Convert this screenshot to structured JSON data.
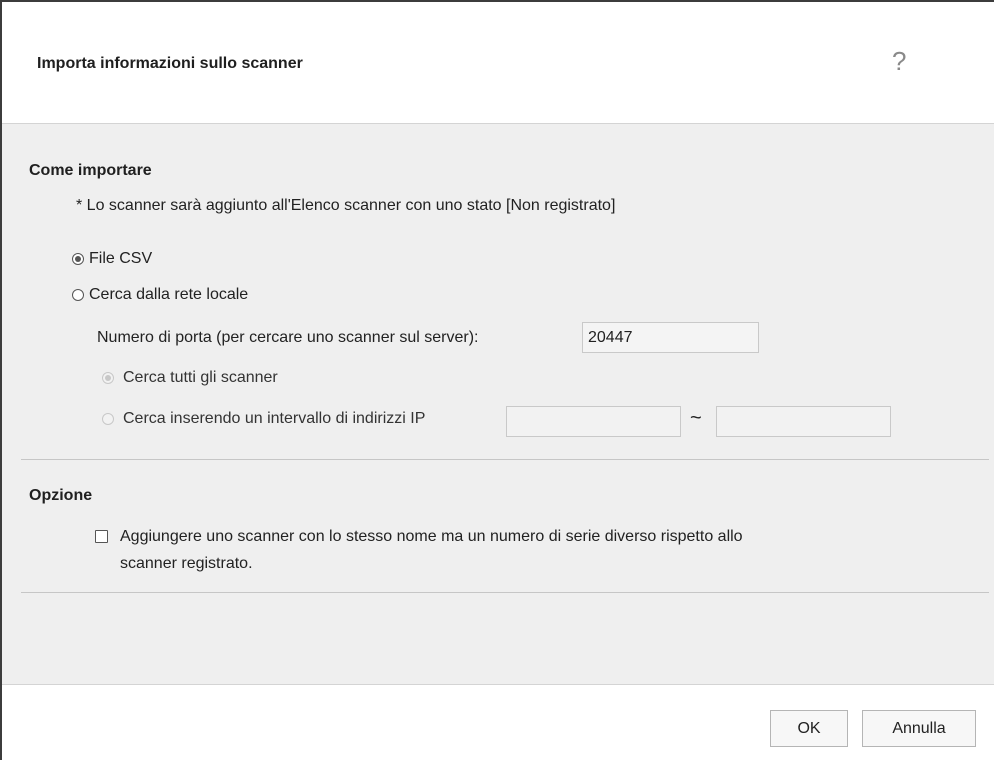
{
  "dialog": {
    "title": "Importa informazioni sullo scanner",
    "help_icon": "?"
  },
  "import_section": {
    "title": "Come importare",
    "note": "* Lo scanner sarà aggiunto all'Elenco scanner con uno stato [Non registrato]",
    "radio_csv": {
      "label": "File CSV",
      "checked": true
    },
    "radio_network": {
      "label": "Cerca dalla rete locale",
      "checked": false
    },
    "port_label": "Numero di porta (per cercare uno scanner sul server):",
    "port_value": "20447",
    "search_all": {
      "label": "Cerca tutti gli scanner",
      "checked": true,
      "enabled": false
    },
    "search_range": {
      "label": "Cerca inserendo un intervallo di indirizzi IP",
      "checked": false,
      "enabled": false
    },
    "ip_start_value": "",
    "ip_end_value": "",
    "range_separator": "~"
  },
  "option_section": {
    "title": "Opzione",
    "checkbox_line1": "Aggiungere uno scanner con lo stesso nome ma un numero di serie diverso rispetto allo",
    "checkbox_line2": "scanner registrato.",
    "checked": false
  },
  "footer": {
    "ok_label": "OK",
    "cancel_label": "Annulla"
  }
}
